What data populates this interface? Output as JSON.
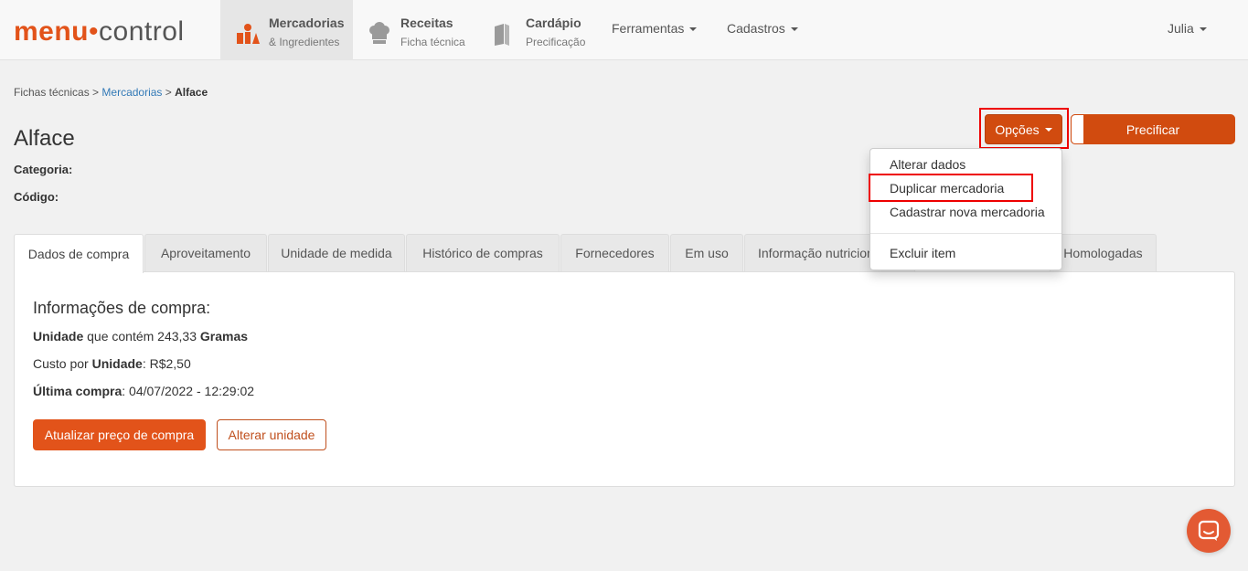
{
  "brand": {
    "menu": "menu",
    "dot": "•",
    "control": "control"
  },
  "nav": {
    "items": [
      {
        "title": "Mercadorias",
        "sub": "& Ingredientes",
        "icon": "ingredients-icon"
      },
      {
        "title": "Receitas",
        "sub": "Ficha técnica",
        "icon": "chef-hat-icon"
      },
      {
        "title": "Cardápio",
        "sub": "Precificação",
        "icon": "menu-book-icon"
      }
    ],
    "ferramentas": "Ferramentas",
    "cadastros": "Cadastros",
    "user": "Julia"
  },
  "breadcrumb": {
    "root": "Fichas técnicas",
    "sep1": ">",
    "link": "Mercadorias",
    "sep2": ">",
    "current": "Alface"
  },
  "page": {
    "title": "Alface",
    "categoria_label": "Categoria:",
    "codigo_label": "Código:"
  },
  "actions": {
    "opcoes": "Opções",
    "precificar": "Precificar"
  },
  "dropdown": {
    "items": [
      "Alterar dados",
      "Duplicar mercadoria",
      "Cadastrar nova mercadoria"
    ],
    "excluir": "Excluir item"
  },
  "tabs": [
    "Dados de compra",
    "Aproveitamento",
    "Unidade de medida",
    "Histórico de compras",
    "Fornecedores",
    "Em uso",
    "Informação nutricional",
    "Homologadas"
  ],
  "compra": {
    "title": "Informações de compra:",
    "unidade_label": "Unidade",
    "unidade_text": " que contém 243,33 ",
    "unidade_unit": "Gramas",
    "custo_prefix": "Custo por ",
    "custo_label": "Unidade",
    "custo_value": ": R$2,50",
    "ultima_label": "Última compra",
    "ultima_value": ": 04/07/2022 - 12:29:02",
    "btn_atualizar": "Atualizar preço de compra",
    "btn_alterar": "Alterar unidade"
  },
  "colors": {
    "accent": "#e2531a",
    "button_dark": "#d14b0f",
    "highlight_frame": "#ee0000",
    "link": "#337ab7"
  }
}
